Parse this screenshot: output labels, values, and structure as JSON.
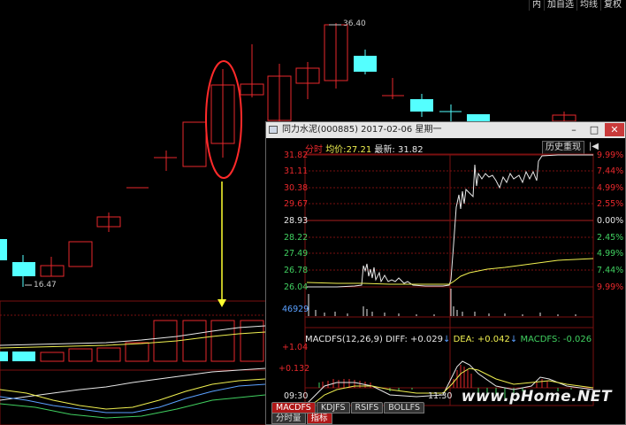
{
  "toolbar": {
    "buttons": [
      "内",
      "加自选",
      "均线",
      "复权"
    ]
  },
  "main_chart": {
    "high_label": "36.40",
    "low_label": "16.47"
  },
  "popup": {
    "title": "同力水泥(000885) 2017-02-06 星期一",
    "mode_label": "分时",
    "avg_label": "均价:",
    "avg_value": "27.21",
    "last_label": "最新:",
    "last_value": "31.82",
    "history_button": "历史重现",
    "price_axis": [
      "31.82",
      "31.11",
      "30.38",
      "29.67",
      "28.93",
      "28.22",
      "27.49",
      "26.78",
      "26.04"
    ],
    "pct_axis": [
      "9.99%",
      "7.44%",
      "4.99%",
      "2.55%",
      "0.00%",
      "2.45%",
      "4.99%",
      "7.44%",
      "9.99%"
    ],
    "volume_label": "46929",
    "macd": {
      "title": "MACDFS(12,26,9)",
      "diff_label": "DIFF:",
      "diff_value": "+0.029",
      "dea_label": "DEA:",
      "dea_value": "+0.042",
      "macd_label": "MACDFS:",
      "macd_value": "-0.026",
      "axis_top": "+1.04",
      "axis_mid": "+0.132"
    },
    "time_axis": [
      "09:30",
      "11:30"
    ],
    "indicator_tabs": [
      "MACDFS",
      "KDJFS",
      "RSIFS",
      "BOLLFS"
    ],
    "bottom_tabs": [
      "分时量",
      "指标"
    ]
  },
  "watermark": "www.pHome.NET",
  "colors": {
    "up": "#e8282c",
    "down": "#54ffff",
    "grid": "#7a1010",
    "white": "#e8e8e8",
    "yellow": "#f0f050",
    "ellipse": "#ff2a2a",
    "arrow": "#ffff30"
  }
}
